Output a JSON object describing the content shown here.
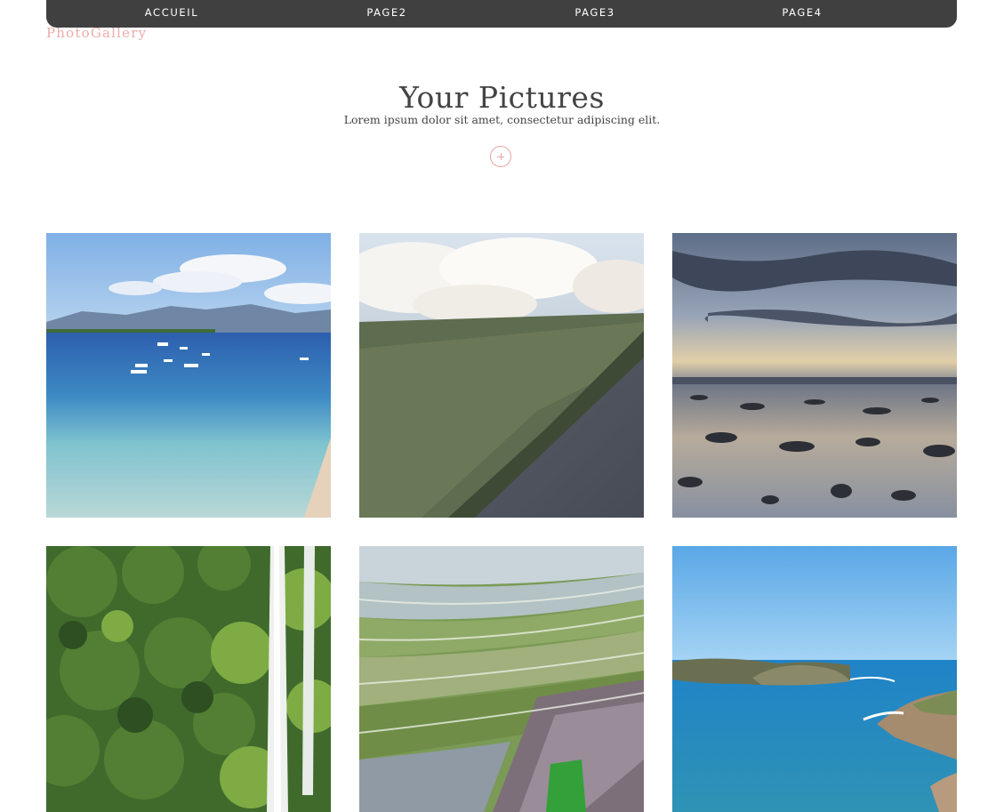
{
  "navbar": {
    "items": [
      {
        "label": "ACCUEIL"
      },
      {
        "label": "PAGE2"
      },
      {
        "label": "PAGE3"
      },
      {
        "label": "PAGE4"
      }
    ]
  },
  "brand": {
    "label": "PhotoGallery"
  },
  "header": {
    "title": "Your Pictures",
    "subtitle": "Lorem ipsum dolor sit amet, consectetur adipiscing elit.",
    "add_icon": "plus-icon"
  },
  "colors": {
    "navbar_bg": "#404040",
    "accent": "#eeaaaa",
    "text": "#444444"
  },
  "gallery": {
    "photos": [
      {
        "subject": "beach-boats"
      },
      {
        "subject": "aerial-cliff-coast"
      },
      {
        "subject": "sunset-rocky-shore"
      },
      {
        "subject": "waterfall-jungle"
      },
      {
        "subject": "rice-terraces"
      },
      {
        "subject": "turquoise-bay"
      }
    ]
  }
}
